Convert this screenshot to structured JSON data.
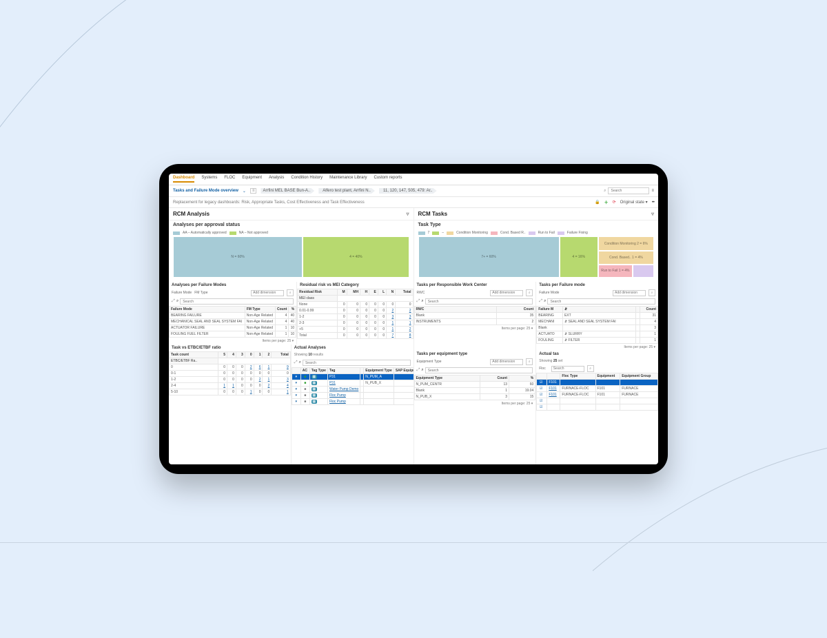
{
  "nav": {
    "tabs": [
      "Dashboard",
      "Systems",
      "FLOC",
      "Equipment",
      "Analysis",
      "Condition History",
      "Maintenance Library",
      "Custom reports"
    ],
    "active": 0
  },
  "header": {
    "title": "Tasks and Failure Mode overview",
    "crumbs": [
      "Arrfini MEL BASE Bun-A..",
      "Alfero test plant, Arrfini N..",
      "11, 120, 147, 505, 479: Ar.."
    ],
    "search_placeholder": "Search",
    "subtitle": "Replacement for legacy dashboards: Risk, Appropriate Tasks, Cost Effectiveness and Task Effectiveness",
    "state_label": "Original state"
  },
  "left": {
    "panel": "RCM Analysis",
    "approval": {
      "title": "Analyses per approval status",
      "legend": [
        {
          "chip": "#a6cbd6",
          "label": "AA – Automatically approved"
        },
        {
          "chip": "#b7d96f",
          "label": "NA – Not approved"
        }
      ],
      "blocks": [
        {
          "label": "N = 60%",
          "w": 55,
          "cls": "bl-blue"
        },
        {
          "label": "4 = 40%",
          "w": 45,
          "cls": "bl-green"
        }
      ]
    },
    "failmodes": {
      "title": "Analyses per Failure Modes",
      "filters": [
        "Failure Mode",
        "FM Type"
      ],
      "dim_placeholder": "Add dimension",
      "search_placeholder": "Search",
      "headers": [
        "Failure Mode",
        "FM Type",
        "Count",
        "%"
      ],
      "rows": [
        [
          "BEARING FAILURE",
          "Non-Age Related",
          "4",
          "40"
        ],
        [
          "MECHANICAL SEAL AND SEAL SYSTEM FAI",
          "Non-Age Related",
          "4",
          "40"
        ],
        [
          "ACTUATOR FAILURE",
          "Non-Age Related",
          "1",
          "10"
        ],
        [
          "FOULING FUEL FILTER",
          "Non-Age Related",
          "1",
          "10"
        ]
      ],
      "pager": "Items per page:  25  ▾"
    },
    "residual": {
      "title": "Residual risk vs MEI Category",
      "row_label": "Residual Risk",
      "col_label": "MEI class",
      "cols": [
        "M",
        "MH",
        "H",
        "E",
        "L",
        "N",
        "Total"
      ],
      "rows": [
        {
          "label": "None",
          "vals": [
            "0",
            "0",
            "0",
            "0",
            "0",
            "0",
            "0"
          ]
        },
        {
          "label": "0.01-0.99",
          "vals": [
            "0",
            "0",
            "0",
            "0",
            "0",
            "2",
            "2"
          ],
          "link": 2
        },
        {
          "label": "1-2",
          "vals": [
            "0",
            "0",
            "0",
            "0",
            "0",
            "3",
            "3"
          ],
          "link": 3
        },
        {
          "label": "2-3",
          "vals": [
            "0",
            "0",
            "0",
            "0",
            "0",
            "1",
            "1"
          ],
          "link": 1
        },
        {
          "label": "+5",
          "vals": [
            "0",
            "0",
            "0",
            "0",
            "0",
            "1",
            "2"
          ],
          "link": 2
        },
        {
          "label": "Total",
          "vals": [
            "0",
            "0",
            "0",
            "0",
            "0",
            "7",
            "8"
          ],
          "link": 8
        }
      ]
    },
    "ratio": {
      "title": "Task vs ETBC/ETBF ratio",
      "row_label": "Task count",
      "col_label": "ETBC/ETBF Ra..",
      "cols": [
        "5",
        "4",
        "3",
        "0",
        "1",
        "2",
        "Total"
      ],
      "rows": [
        {
          "label": "0",
          "vals": [
            "0",
            "0",
            "0",
            "2",
            "6",
            "1",
            "9"
          ],
          "link": 9
        },
        {
          "label": "0-1",
          "vals": [
            "0",
            "0",
            "0",
            "0",
            "0",
            "0",
            "0"
          ]
        },
        {
          "label": "1-2",
          "vals": [
            "0",
            "0",
            "0",
            "0",
            "2",
            "1",
            "3"
          ],
          "link": 3
        },
        {
          "label": "2-4",
          "vals": [
            "1",
            "1",
            "0",
            "0",
            "0",
            "2",
            "4"
          ],
          "link": 4
        },
        {
          "label": "5-10",
          "vals": [
            "0",
            "0",
            "0",
            "1",
            "0",
            "0",
            "1"
          ]
        }
      ]
    },
    "actual": {
      "title": "Actual Analyses",
      "showing": [
        "Showing ",
        "10",
        " results"
      ],
      "search_placeholder": "Search",
      "headers": [
        "",
        "AC",
        "Tag Type",
        "Tag",
        "",
        "Equipment Type",
        "SAP Equipment"
      ],
      "rows": [
        {
          "sel": true,
          "cells": [
            "▾",
            "◼",
            "◧",
            "P31",
            "",
            "N_PUM_A",
            ""
          ]
        },
        {
          "sel": false,
          "cells": [
            "▾",
            "◼",
            "◧",
            "P31",
            "",
            "N_PUB_X",
            ""
          ]
        },
        {
          "sel": false,
          "cells": [
            "▾",
            "◼",
            "◧",
            "Water Pump Demo",
            "",
            "",
            ""
          ]
        },
        {
          "sel": false,
          "cells": [
            "▾",
            "◼",
            "◧",
            "Floc Pump",
            "",
            "",
            ""
          ]
        },
        {
          "sel": false,
          "cells": [
            "▾",
            "◼",
            "◧",
            "Floc Pump",
            "",
            "",
            ""
          ]
        }
      ]
    }
  },
  "right": {
    "panel": "RCM Tasks",
    "tasktype": {
      "title": "Task Type",
      "legend": [
        {
          "chip": "#a6cbd6",
          "label": "7"
        },
        {
          "chip": "#b7d96f",
          "label": "–"
        },
        {
          "chip": "#f0d7a0",
          "label": "Condition Monitoring"
        },
        {
          "chip": "#f5b6bd",
          "label": "Cond. Based R.."
        },
        {
          "chip": "#d9c9ef",
          "label": "Run to Fail"
        },
        {
          "chip": "#d9c9ef",
          "label": "Failure Fixing"
        }
      ],
      "left_block": {
        "label": "7+ = 60%"
      },
      "mid_block": {
        "label": "4 = 16%"
      },
      "small": [
        {
          "cls": "bl-sand",
          "label": "Condition Monitoring 2 = 6%"
        },
        {
          "cls": "bl-sand",
          "label": "Cond. Based.. 1 = 4%"
        },
        {
          "cls": "bl-pink",
          "label": "Run to Fail 1 = 4%"
        },
        {
          "cls": "bl-lilac",
          "label": ""
        }
      ]
    },
    "rwc": {
      "title": "Tasks per Responsible Work Center",
      "label": "RWC",
      "dim_placeholder": "Add dimension",
      "search_placeholder": "Search",
      "headers": [
        "RWC",
        "Count"
      ],
      "rows": [
        [
          "Blank",
          "35"
        ],
        [
          "INSTRUMENTS",
          "2"
        ]
      ],
      "pager": "Items per page:  25  ▾"
    },
    "fm": {
      "title": "Tasks per Failure mode",
      "label": "Failure Mode",
      "dim_placeholder": "Add dimension",
      "search_placeholder": "Search",
      "headers": [
        "Failure M",
        "⇵",
        "",
        "Count"
      ],
      "rows": [
        [
          "BEARING",
          "EXT",
          "",
          "31"
        ],
        [
          "MECHANI",
          "⇵ SEAL AND SEAL SYSTEM FAI",
          "",
          "4"
        ],
        [
          "Blank",
          "",
          "",
          "3"
        ],
        [
          "ACTUATO",
          "⇵ SLURRY",
          "",
          "1"
        ],
        [
          "FOULING",
          "⇵ FILTER",
          "",
          "1"
        ]
      ],
      "pager": "Items per page:  25  ▾"
    },
    "eqtype": {
      "title": "Tasks per equipment type",
      "label": "Equipment Type",
      "dim_placeholder": "Add dimension",
      "search_placeholder": "Search",
      "headers": [
        "Equipment Type",
        "Count",
        "%"
      ],
      "rows": [
        [
          "N_PUM_CENTR",
          "13",
          "60"
        ],
        [
          "Blank",
          "1",
          "19.04"
        ],
        [
          "N_PUB_X",
          "3",
          "15"
        ]
      ],
      "pager": "Items per page:  25  ▾"
    },
    "actualtas": {
      "title": "Actual tas",
      "showing": [
        "Showing ",
        "25",
        " set"
      ],
      "label": "Floc",
      "search_placeholder": "Search",
      "headers": [
        "",
        "",
        "Floc Type",
        "Equipment",
        "Equipment Group"
      ],
      "rows": [
        {
          "sel": true,
          "cells": [
            "☑",
            "F101",
            "",
            "",
            ""
          ]
        },
        {
          "sel": false,
          "cells": [
            "☑",
            "F101",
            "FURNACE-FLOC",
            "F101",
            "FURNACE"
          ]
        },
        {
          "sel": false,
          "cells": [
            "☑",
            "F101",
            "FURNACE-FLOC",
            "F101",
            "FURNACE"
          ]
        },
        {
          "sel": false,
          "cells": [
            "☑",
            "",
            "",
            "",
            ""
          ]
        },
        {
          "sel": false,
          "cells": [
            "☑",
            "",
            "",
            "",
            ""
          ]
        }
      ]
    }
  },
  "chart_data": [
    {
      "type": "treemap",
      "title": "Analyses per approval status",
      "series": [
        {
          "name": "AA – Automatically approved",
          "value": 60
        },
        {
          "name": "NA – Not approved",
          "value": 40
        }
      ]
    },
    {
      "type": "treemap",
      "title": "Task Type",
      "series": [
        {
          "name": "7",
          "value": 60
        },
        {
          "name": "–",
          "value": 16
        },
        {
          "name": "Condition Monitoring",
          "value": 6
        },
        {
          "name": "Cond. Based R..",
          "value": 4
        },
        {
          "name": "Run to Fail",
          "value": 4
        },
        {
          "name": "Failure Fixing",
          "value": 4
        }
      ]
    }
  ]
}
